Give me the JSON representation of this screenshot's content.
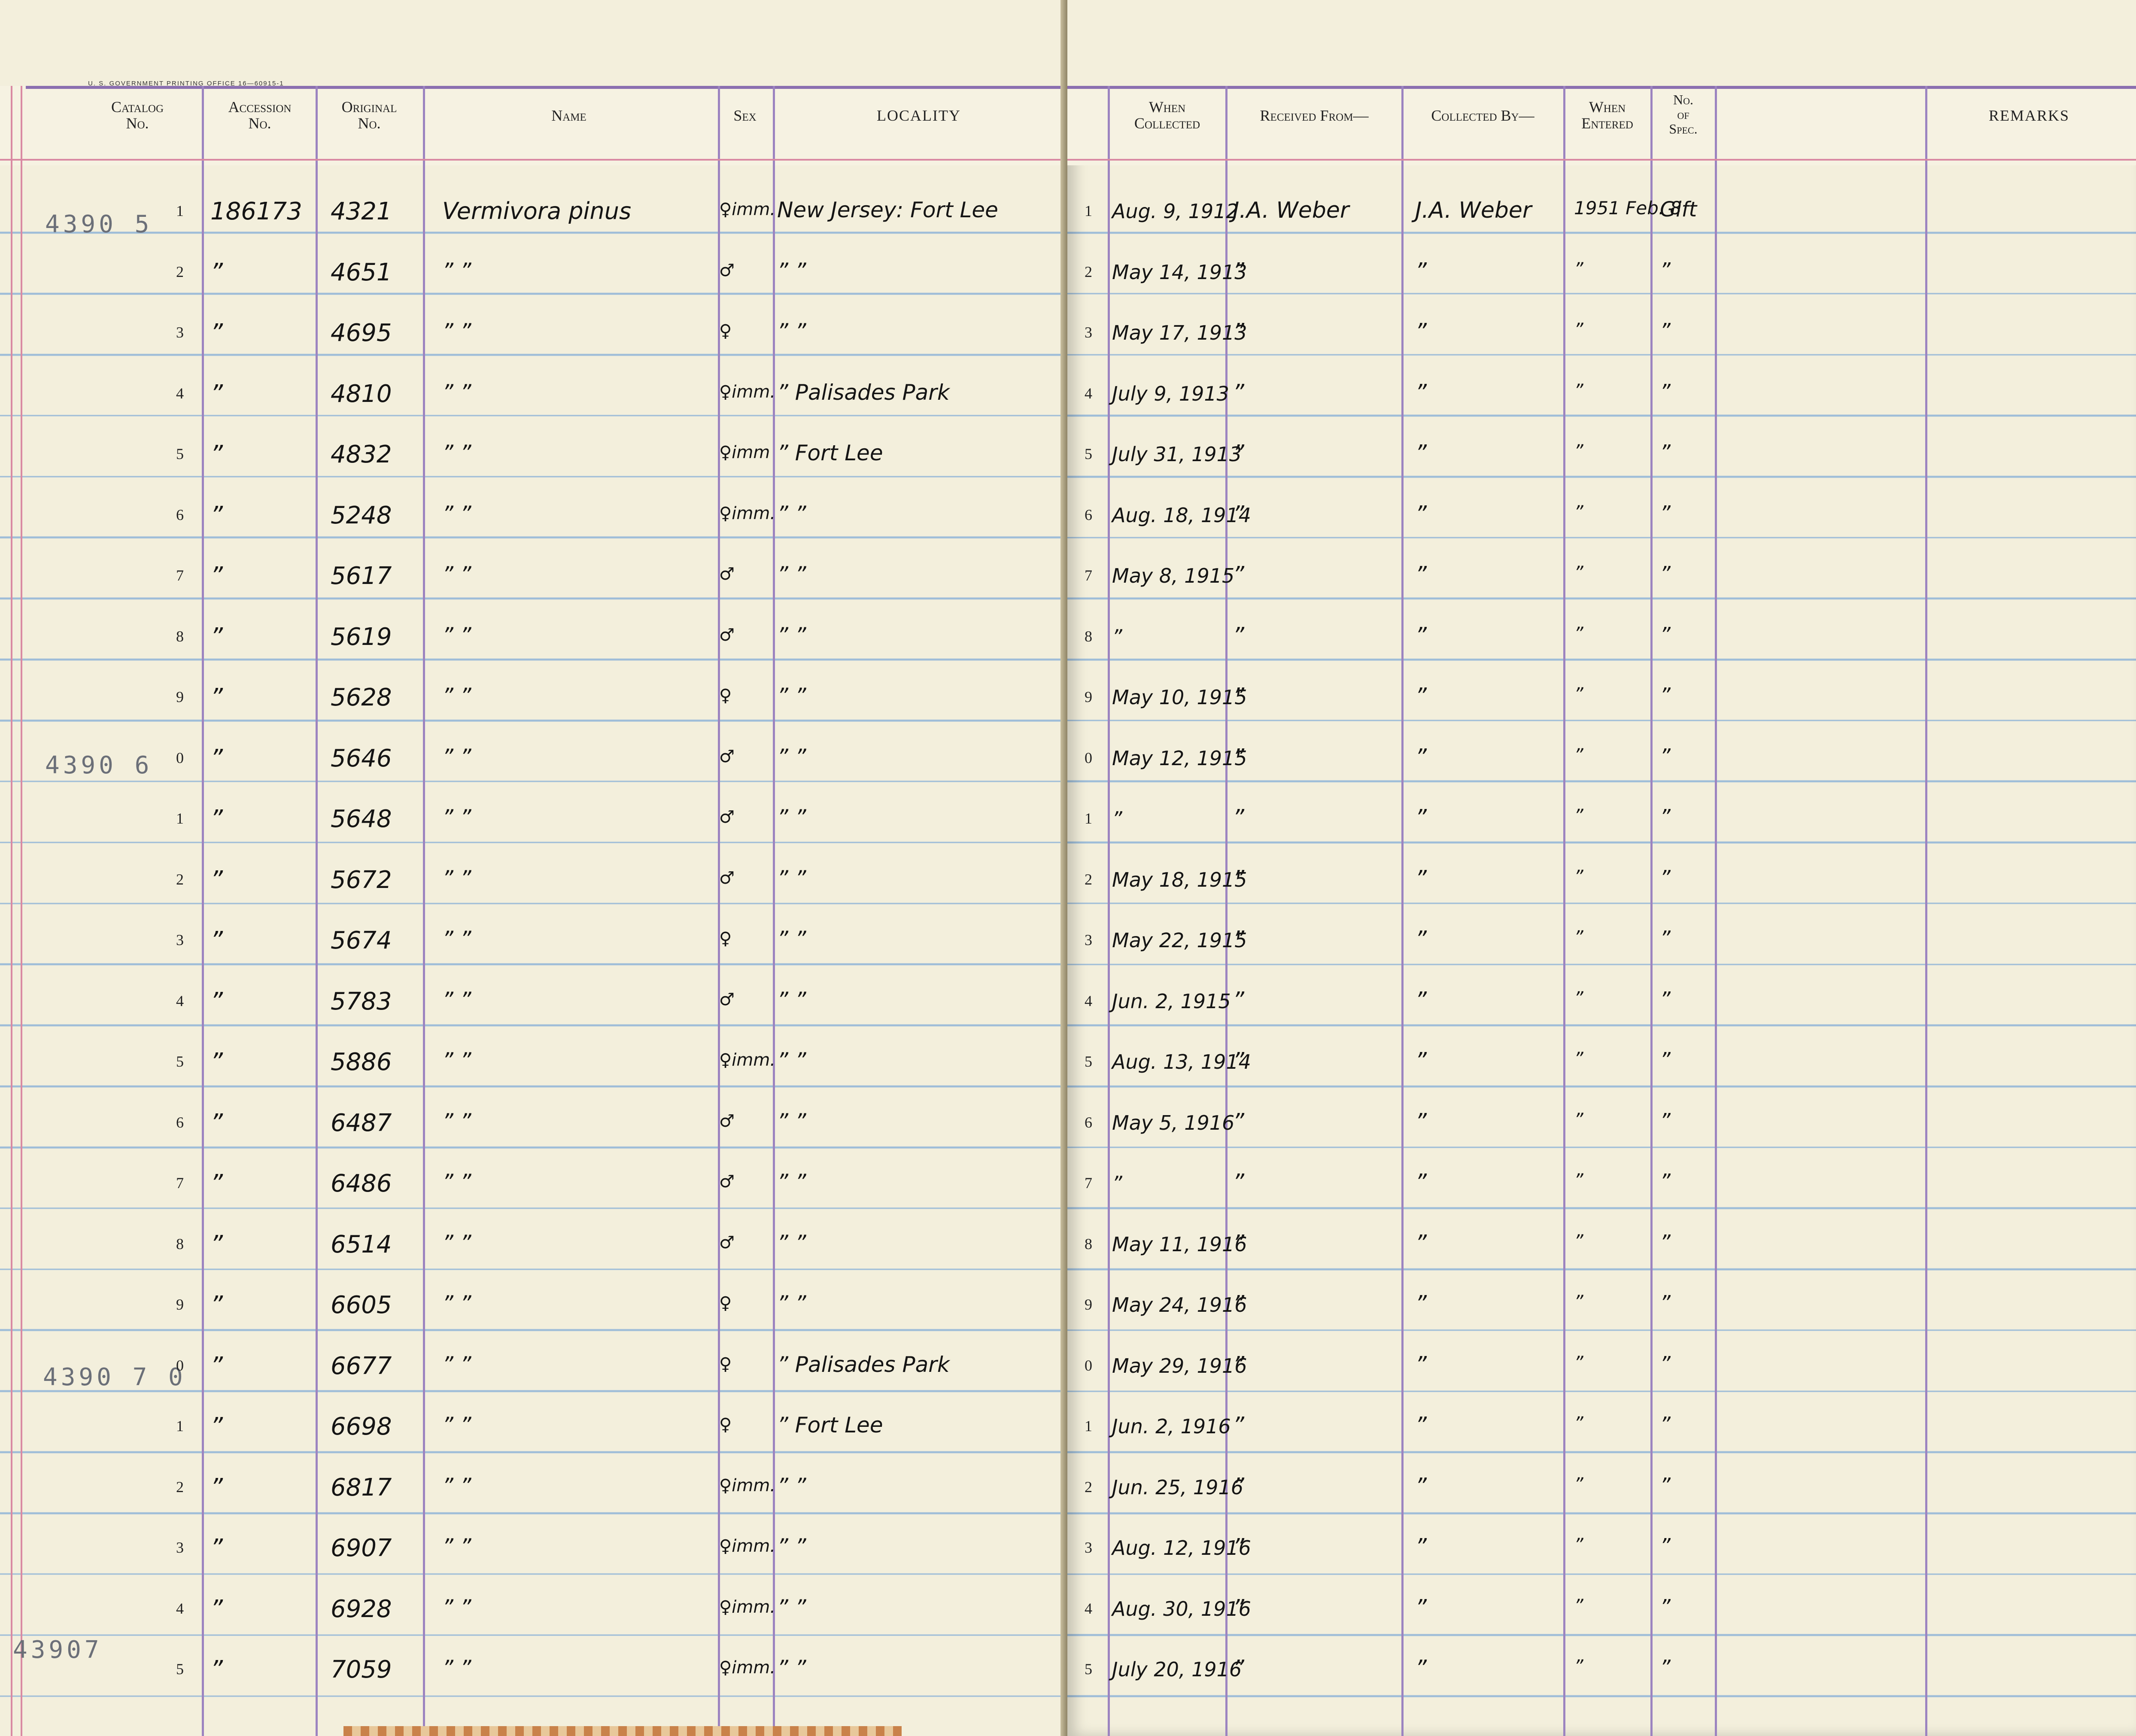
{
  "printing_office": "U. S. GOVERNMENT PRINTING OFFICE 16—60915-1",
  "headers": {
    "catalog": [
      "Catalog",
      "No."
    ],
    "accession": [
      "Accession",
      "No."
    ],
    "original": [
      "Original",
      "No."
    ],
    "name": "Name",
    "sex": "Sex",
    "locality": "LOCALITY",
    "when_collected": [
      "When",
      "Collected"
    ],
    "received_from": "Received From—",
    "collected_by": "Collected By—",
    "when_entered": [
      "When",
      "Entered"
    ],
    "no_of_spec": [
      "No.",
      "of",
      "Spec."
    ],
    "remarks": "REMARKS"
  },
  "catalog_stamps": [
    "4390 5",
    "4390 6",
    "4390 7 0",
    "43907"
  ],
  "rows": [
    {
      "line": "1",
      "accession": "186173",
      "original": "4321",
      "name": "Vermivora pinus",
      "sex": "♀imm.",
      "locality": "New Jersey: Fort Lee",
      "when_collected": "Aug. 9, 1912",
      "received_from": "J.A. Weber",
      "collected_by": "J.A. Weber",
      "when_entered": "1951 Feb. 8",
      "no_spec": "Gift"
    },
    {
      "line": "2",
      "accession": "”",
      "original": "4651",
      "name": "” ”",
      "sex": "♂",
      "locality": "” ”",
      "when_collected": "May 14, 1913",
      "received_from": "”",
      "collected_by": "”",
      "when_entered": "”",
      "no_spec": "”"
    },
    {
      "line": "3",
      "accession": "”",
      "original": "4695",
      "name": "” ”",
      "sex": "♀",
      "locality": "” ”",
      "when_collected": "May 17, 1913",
      "received_from": "”",
      "collected_by": "”",
      "when_entered": "”",
      "no_spec": "”"
    },
    {
      "line": "4",
      "accession": "”",
      "original": "4810",
      "name": "” ”",
      "sex": "♀imm.",
      "locality": "” Palisades Park",
      "when_collected": "July 9, 1913",
      "received_from": "”",
      "collected_by": "”",
      "when_entered": "”",
      "no_spec": "”"
    },
    {
      "line": "5",
      "accession": "”",
      "original": "4832",
      "name": "” ”",
      "sex": "♀imm",
      "locality": "” Fort Lee",
      "when_collected": "July 31, 1913",
      "received_from": "”",
      "collected_by": "”",
      "when_entered": "”",
      "no_spec": "”"
    },
    {
      "line": "6",
      "accession": "”",
      "original": "5248",
      "name": "” ”",
      "sex": "♀imm.",
      "locality": "” ”",
      "when_collected": "Aug. 18, 1914",
      "received_from": "”",
      "collected_by": "”",
      "when_entered": "”",
      "no_spec": "”"
    },
    {
      "line": "7",
      "accession": "”",
      "original": "5617",
      "name": "” ”",
      "sex": "♂",
      "locality": "” ”",
      "when_collected": "May 8, 1915",
      "received_from": "”",
      "collected_by": "”",
      "when_entered": "”",
      "no_spec": "”"
    },
    {
      "line": "8",
      "accession": "”",
      "original": "5619",
      "name": "” ”",
      "sex": "♂",
      "locality": "” ”",
      "when_collected": "”",
      "received_from": "”",
      "collected_by": "”",
      "when_entered": "”",
      "no_spec": "”"
    },
    {
      "line": "9",
      "accession": "”",
      "original": "5628",
      "name": "” ”",
      "sex": "♀",
      "locality": "” ”",
      "when_collected": "May 10, 1915",
      "received_from": "”",
      "collected_by": "”",
      "when_entered": "”",
      "no_spec": "”"
    },
    {
      "line": "0",
      "accession": "”",
      "original": "5646",
      "name": "” ”",
      "sex": "♂",
      "locality": "” ”",
      "when_collected": "May 12, 1915",
      "received_from": "”",
      "collected_by": "”",
      "when_entered": "”",
      "no_spec": "”"
    },
    {
      "line": "1",
      "accession": "”",
      "original": "5648",
      "name": "” ”",
      "sex": "♂",
      "locality": "” ”",
      "when_collected": "”",
      "received_from": "”",
      "collected_by": "”",
      "when_entered": "”",
      "no_spec": "”"
    },
    {
      "line": "2",
      "accession": "”",
      "original": "5672",
      "name": "” ”",
      "sex": "♂",
      "locality": "” ”",
      "when_collected": "May 18, 1915",
      "received_from": "”",
      "collected_by": "”",
      "when_entered": "”",
      "no_spec": "”"
    },
    {
      "line": "3",
      "accession": "”",
      "original": "5674",
      "name": "” ”",
      "sex": "♀",
      "locality": "” ”",
      "when_collected": "May 22, 1915",
      "received_from": "”",
      "collected_by": "”",
      "when_entered": "”",
      "no_spec": "”"
    },
    {
      "line": "4",
      "accession": "”",
      "original": "5783",
      "name": "” ”",
      "sex": "♂",
      "locality": "” ”",
      "when_collected": "Jun. 2, 1915",
      "received_from": "”",
      "collected_by": "”",
      "when_entered": "”",
      "no_spec": "”"
    },
    {
      "line": "5",
      "accession": "”",
      "original": "5886",
      "name": "” ”",
      "sex": "♀imm.",
      "locality": "” ”",
      "when_collected": "Aug. 13, 1914",
      "received_from": "”",
      "collected_by": "”",
      "when_entered": "”",
      "no_spec": "”"
    },
    {
      "line": "6",
      "accession": "”",
      "original": "6487",
      "name": "” ”",
      "sex": "♂",
      "locality": "” ”",
      "when_collected": "May 5, 1916",
      "received_from": "”",
      "collected_by": "”",
      "when_entered": "”",
      "no_spec": "”"
    },
    {
      "line": "7",
      "accession": "”",
      "original": "6486",
      "name": "” ”",
      "sex": "♂",
      "locality": "” ”",
      "when_collected": "”",
      "received_from": "”",
      "collected_by": "”",
      "when_entered": "”",
      "no_spec": "”"
    },
    {
      "line": "8",
      "accession": "”",
      "original": "6514",
      "name": "” ”",
      "sex": "♂",
      "locality": "” ”",
      "when_collected": "May 11, 1916",
      "received_from": "”",
      "collected_by": "”",
      "when_entered": "”",
      "no_spec": "”"
    },
    {
      "line": "9",
      "accession": "”",
      "original": "6605",
      "name": "” ”",
      "sex": "♀",
      "locality": "” ”",
      "when_collected": "May 24, 1916",
      "received_from": "”",
      "collected_by": "”",
      "when_entered": "”",
      "no_spec": "”"
    },
    {
      "line": "0",
      "accession": "”",
      "original": "6677",
      "name": "” ”",
      "sex": "♀",
      "locality": "” Palisades Park",
      "when_collected": "May 29, 1916",
      "received_from": "”",
      "collected_by": "”",
      "when_entered": "”",
      "no_spec": "”"
    },
    {
      "line": "1",
      "accession": "”",
      "original": "6698",
      "name": "” ”",
      "sex": "♀",
      "locality": "” Fort Lee",
      "when_collected": "Jun. 2, 1916",
      "received_from": "”",
      "collected_by": "”",
      "when_entered": "”",
      "no_spec": "”"
    },
    {
      "line": "2",
      "accession": "”",
      "original": "6817",
      "name": "” ”",
      "sex": "♀imm.",
      "locality": "” ”",
      "when_collected": "Jun. 25, 1916",
      "received_from": "”",
      "collected_by": "”",
      "when_entered": "”",
      "no_spec": "”"
    },
    {
      "line": "3",
      "accession": "”",
      "original": "6907",
      "name": "” ”",
      "sex": "♀imm.",
      "locality": "” ”",
      "when_collected": "Aug. 12, 1916",
      "received_from": "”",
      "collected_by": "”",
      "when_entered": "”",
      "no_spec": "”"
    },
    {
      "line": "4",
      "accession": "”",
      "original": "6928",
      "name": "” ”",
      "sex": "♀imm.",
      "locality": "” ”",
      "when_collected": "Aug. 30, 1916",
      "received_from": "”",
      "collected_by": "”",
      "when_entered": "”",
      "no_spec": "”"
    },
    {
      "line": "5",
      "accession": "”",
      "original": "7059",
      "name": "” ”",
      "sex": "♀imm.",
      "locality": "” ”",
      "when_collected": "July 20, 1916",
      "received_from": "”",
      "collected_by": "”",
      "when_entered": "”",
      "no_spec": "”"
    }
  ]
}
